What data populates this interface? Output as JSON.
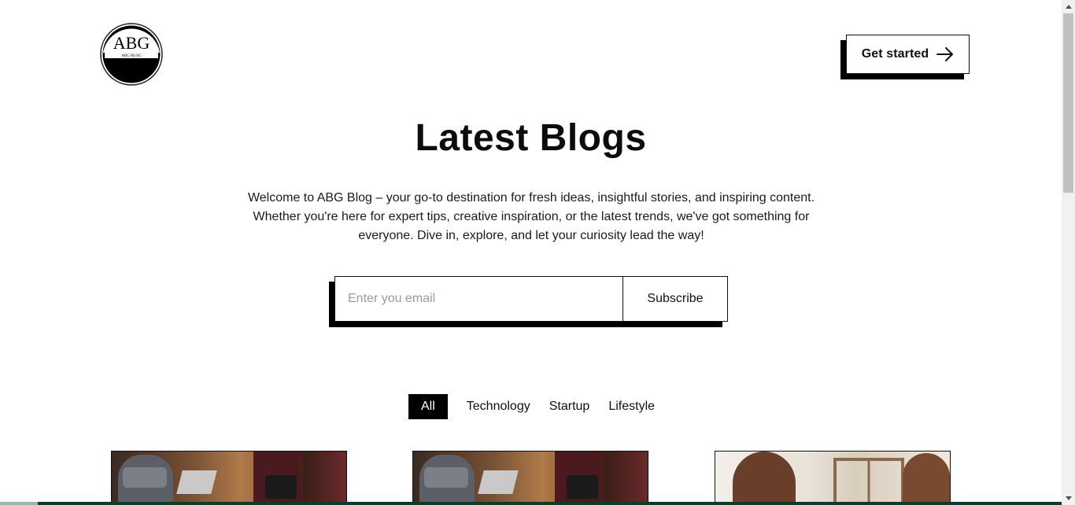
{
  "header": {
    "logo_text": "ABG",
    "logo_subtext": "ABG BLOG",
    "cta_label": "Get started",
    "cta_icon": "arrow-right-icon"
  },
  "hero": {
    "title": "Latest Blogs",
    "description": "Welcome to ABG Blog – your go-to destination for fresh ideas, insightful stories, and inspiring content. Whether you're here for expert tips, creative inspiration, or the latest trends, we've got something for everyone. Dive in, explore, and let your curiosity lead the way!"
  },
  "subscribe": {
    "placeholder": "Enter you email",
    "value": "",
    "button_label": "Subscribe"
  },
  "filters": {
    "items": [
      {
        "label": "All",
        "active": true
      },
      {
        "label": "Technology",
        "active": false
      },
      {
        "label": "Startup",
        "active": false
      },
      {
        "label": "Lifestyle",
        "active": false
      }
    ]
  },
  "colors": {
    "accent": "#000000",
    "background": "#ffffff",
    "bottom_bar": "#0e3b2a"
  }
}
